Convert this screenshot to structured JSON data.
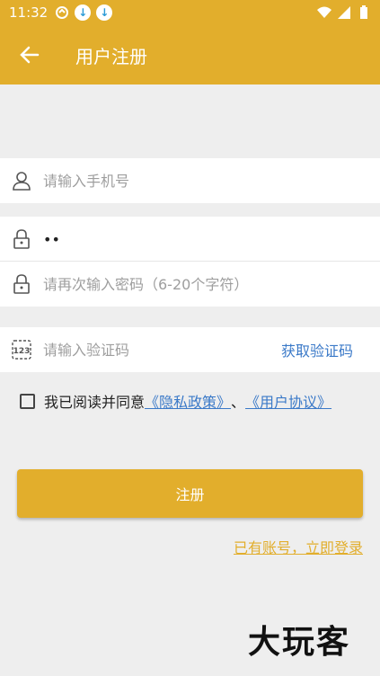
{
  "status_bar": {
    "time": "11:32",
    "icons": [
      "notification-icon",
      "download-icon",
      "download-icon",
      "wifi-icon",
      "signal-icon",
      "battery-icon"
    ]
  },
  "app_bar": {
    "title": "用户注册",
    "back_icon": "arrow-left-icon"
  },
  "form": {
    "phone": {
      "placeholder": "请输入手机号",
      "value": "",
      "icon": "user-icon"
    },
    "password": {
      "value": "••",
      "icon": "lock-icon"
    },
    "password_confirm": {
      "placeholder": "请再次输入密码（6-20个字符）",
      "value": "",
      "icon": "lock-icon"
    },
    "code": {
      "placeholder": "请输入验证码",
      "value": "",
      "icon": "number-123-icon"
    },
    "get_code_label": "获取验证码"
  },
  "agreement": {
    "checked": false,
    "prefix": "我已阅读并同意",
    "privacy_link": "《隐私政策》",
    "separator": "、",
    "user_link": "《用户协议》"
  },
  "register_button": "注册",
  "login_link": "已有账号，立即登录",
  "watermark": "大玩客",
  "colors": {
    "accent": "#e2ae2c",
    "link": "#3a79c8",
    "background": "#eeeeee"
  }
}
